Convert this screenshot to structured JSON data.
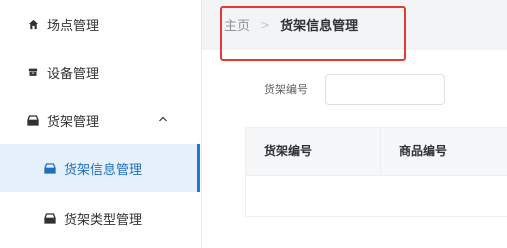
{
  "sidebar": {
    "items": [
      {
        "label": "场点管理",
        "icon": "home-icon"
      },
      {
        "label": "设备管理",
        "icon": "device-box-icon"
      },
      {
        "label": "货架管理",
        "icon": "shelf-icon",
        "expanded": true
      },
      {
        "label": "货架信息管理",
        "icon": "shelf-icon",
        "active": true
      },
      {
        "label": "货架类型管理",
        "icon": "shelf-icon"
      }
    ]
  },
  "breadcrumb": {
    "home": "主页",
    "separator": ">",
    "current": "货架信息管理"
  },
  "filter": {
    "label": "货架编号",
    "value": ""
  },
  "table": {
    "columns": [
      "货架编号",
      "商品编号"
    ]
  },
  "colors": {
    "accent": "#1f7ad6",
    "highlight": "#e53935",
    "sidebar_bg": "#ffffff",
    "page_bg": "#f0f2f5"
  }
}
